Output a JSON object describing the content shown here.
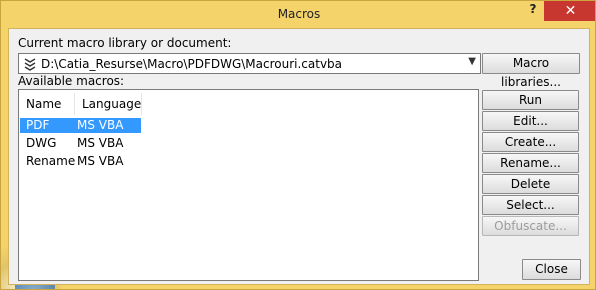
{
  "window": {
    "title": "Macros",
    "help_symbol": "?",
    "close_symbol": "✕"
  },
  "library": {
    "label": "Current macro library or document:",
    "path": "D:\\Catia_Resurse\\Macro\\PDFDWG\\Macrouri.catvba",
    "libraries_button": "Macro libraries..."
  },
  "macros": {
    "label": "Available macros:",
    "columns": [
      "Name",
      "Language"
    ],
    "rows": [
      {
        "name": "PDF",
        "language": "MS VBA",
        "selected": true
      },
      {
        "name": "DWG",
        "language": "MS VBA",
        "selected": false
      },
      {
        "name": "Rename",
        "language": "MS VBA",
        "selected": false
      }
    ]
  },
  "buttons": {
    "run": "Run",
    "edit": "Edit...",
    "create": "Create...",
    "rename": "Rename...",
    "delete": "Delete",
    "select": "Select...",
    "obfuscate": "Obfuscate...",
    "close": "Close"
  },
  "icons": {
    "combo_icon": "library-icon",
    "dropdown": "chevron-down-icon"
  }
}
